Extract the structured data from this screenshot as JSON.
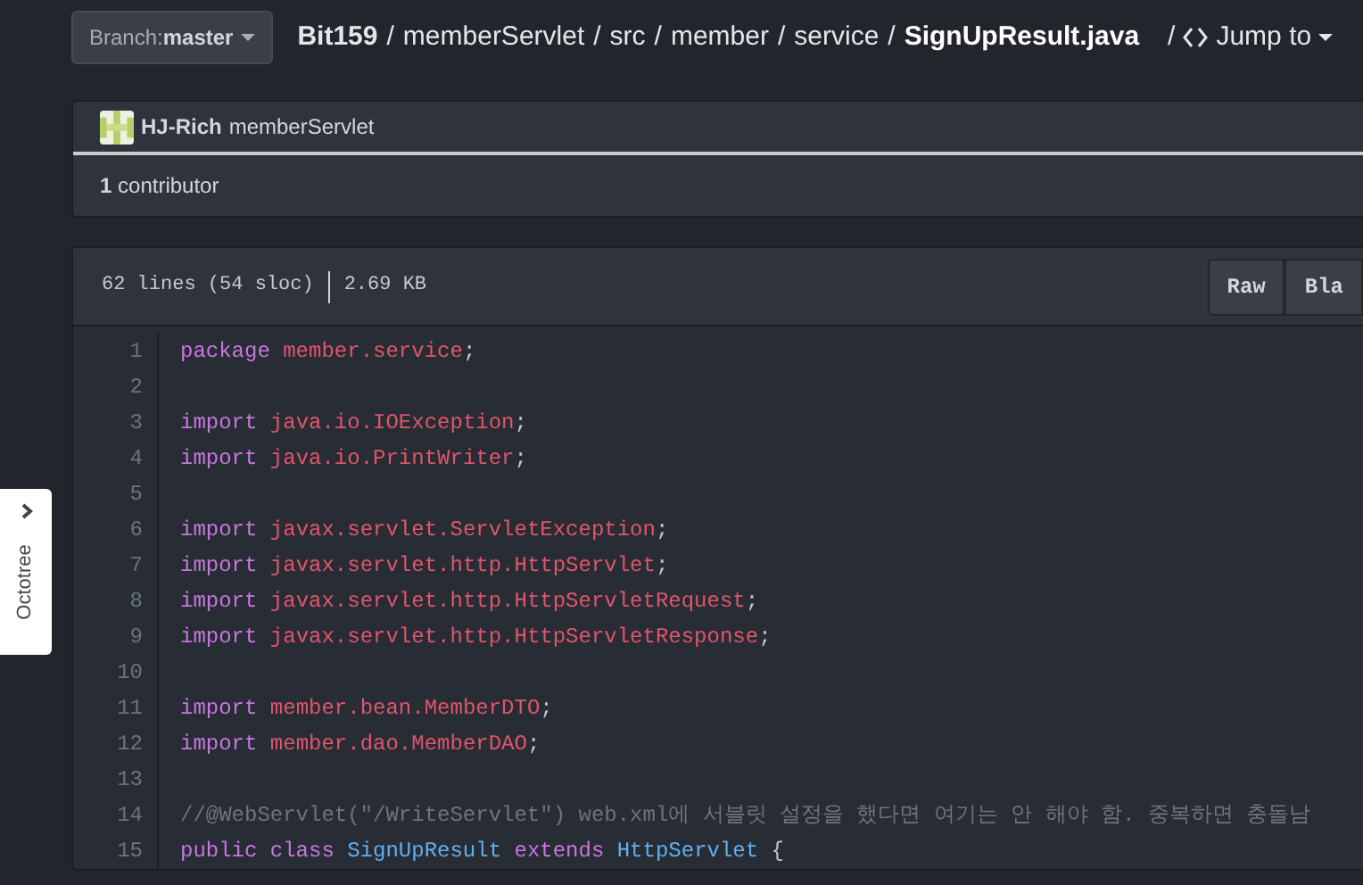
{
  "branch": {
    "label": "Branch:",
    "value": "master"
  },
  "breadcrumb": [
    {
      "kind": "root",
      "text": "Bit159"
    },
    {
      "kind": "separator",
      "text": "/"
    },
    {
      "kind": "link",
      "text": "memberServlet"
    },
    {
      "kind": "separator",
      "text": "/"
    },
    {
      "kind": "link",
      "text": "src"
    },
    {
      "kind": "separator",
      "text": "/"
    },
    {
      "kind": "link",
      "text": "member"
    },
    {
      "kind": "separator",
      "text": "/"
    },
    {
      "kind": "link",
      "text": "service"
    },
    {
      "kind": "separator",
      "text": "/"
    },
    {
      "kind": "current",
      "text": "SignUpResult.java"
    },
    {
      "kind": "separator",
      "text": "/"
    },
    {
      "kind": "jump",
      "text": "Jump to"
    }
  ],
  "commit": {
    "author": "HJ-Rich",
    "message": "memberServlet"
  },
  "contributors": {
    "count": "1",
    "label": "contributor"
  },
  "file_info": {
    "lines": "62 lines (54 sloc)",
    "size": "2.69 KB"
  },
  "file_buttons": [
    "Raw",
    "Bla"
  ],
  "code_lines": [
    {
      "number": "1",
      "tokens": [
        {
          "kind": "keyword",
          "text": "package "
        },
        {
          "kind": "name",
          "text": "member.service"
        },
        {
          "kind": "plain",
          "text": ";"
        }
      ]
    },
    {
      "number": "2"
    },
    {
      "number": "3",
      "tokens": [
        {
          "kind": "keyword",
          "text": "import "
        },
        {
          "kind": "name",
          "text": "java.io.IOException"
        },
        {
          "kind": "plain",
          "text": ";"
        }
      ]
    },
    {
      "number": "4",
      "tokens": [
        {
          "kind": "keyword",
          "text": "import "
        },
        {
          "kind": "name",
          "text": "java.io.PrintWriter"
        },
        {
          "kind": "plain",
          "text": ";"
        }
      ]
    },
    {
      "number": "5"
    },
    {
      "number": "6",
      "tokens": [
        {
          "kind": "keyword",
          "text": "import "
        },
        {
          "kind": "name",
          "text": "javax.servlet.ServletException"
        },
        {
          "kind": "plain",
          "text": ";"
        }
      ]
    },
    {
      "number": "7",
      "tokens": [
        {
          "kind": "keyword",
          "text": "import "
        },
        {
          "kind": "name",
          "text": "javax.servlet.http.HttpServlet"
        },
        {
          "kind": "plain",
          "text": ";"
        }
      ]
    },
    {
      "number": "8",
      "tokens": [
        {
          "kind": "keyword",
          "text": "import "
        },
        {
          "kind": "name",
          "text": "javax.servlet.http.HttpServletRequest"
        },
        {
          "kind": "plain",
          "text": ";"
        }
      ]
    },
    {
      "number": "9",
      "tokens": [
        {
          "kind": "keyword",
          "text": "import "
        },
        {
          "kind": "name",
          "text": "javax.servlet.http.HttpServletResponse"
        },
        {
          "kind": "plain",
          "text": ";"
        }
      ]
    },
    {
      "number": "10"
    },
    {
      "number": "11",
      "tokens": [
        {
          "kind": "keyword",
          "text": "import "
        },
        {
          "kind": "name",
          "text": "member.bean.MemberDTO"
        },
        {
          "kind": "plain",
          "text": ";"
        }
      ]
    },
    {
      "number": "12",
      "tokens": [
        {
          "kind": "keyword",
          "text": "import "
        },
        {
          "kind": "name",
          "text": "member.dao.MemberDAO"
        },
        {
          "kind": "plain",
          "text": ";"
        }
      ]
    },
    {
      "number": "13"
    },
    {
      "number": "14",
      "tokens": [
        {
          "kind": "comment",
          "text": "//@WebServlet(\"/WriteServlet\") web.xml에 서블릿 설정을 했다면 여기는 안 해야 함. 중복하면 충돌남"
        }
      ]
    },
    {
      "number": "15",
      "tokens": [
        {
          "kind": "keyword",
          "text": "public class "
        },
        {
          "kind": "type",
          "text": "SignUpResult "
        },
        {
          "kind": "keyword",
          "text": "extends "
        },
        {
          "kind": "type",
          "text": "HttpServlet "
        },
        {
          "kind": "plain",
          "text": "{"
        }
      ]
    }
  ],
  "octotree": {
    "label": "Octotree"
  }
}
